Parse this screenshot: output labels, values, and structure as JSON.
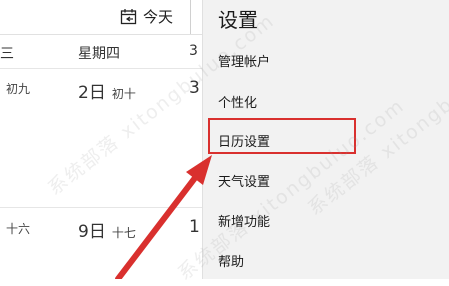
{
  "toolbar": {
    "today_label": "今天"
  },
  "calendar": {
    "weekdays": [
      {
        "label": "三"
      },
      {
        "label": "星期四"
      },
      {
        "label": "3"
      }
    ],
    "week1": [
      {
        "day": "",
        "lunar": "初九"
      },
      {
        "day": "2日",
        "lunar": "初十"
      },
      {
        "day": "3",
        "lunar": ""
      }
    ],
    "week2": [
      {
        "day": "",
        "lunar": "十六"
      },
      {
        "day": "9日",
        "lunar": "十七"
      },
      {
        "day": "1",
        "lunar": ""
      }
    ]
  },
  "settings_menu": {
    "title": "设置",
    "items": [
      {
        "label": "管理帐户"
      },
      {
        "label": "个性化"
      },
      {
        "label": "日历设置"
      },
      {
        "label": "天气设置"
      },
      {
        "label": "新增功能"
      },
      {
        "label": "帮助"
      }
    ]
  },
  "annotation": {
    "highlight_color": "#d9302e",
    "highlighted_item": "日历设置"
  },
  "watermark": {
    "text": "系统部落 xitongbuluo.com"
  }
}
